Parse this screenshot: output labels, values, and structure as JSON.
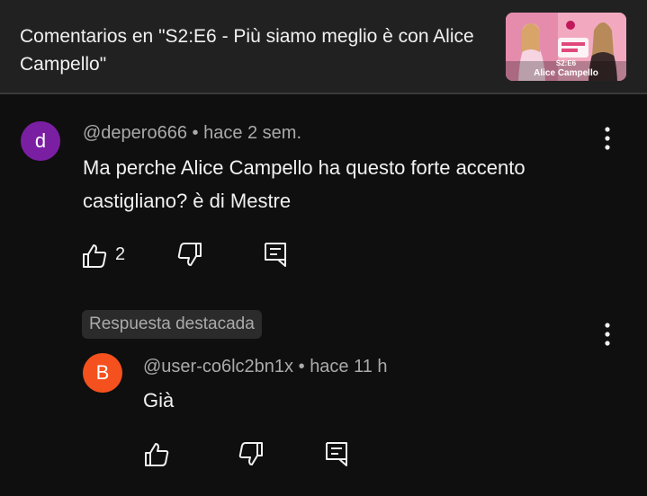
{
  "header": {
    "title": "Comentarios en \"S2:E6 - Più siamo meglio è con Alice Campello\"",
    "thumbnail": {
      "episode": "S2:E6",
      "name": "Alice Campello"
    }
  },
  "comments": [
    {
      "avatar_letter": "d",
      "avatar_color": "#7b1fa2",
      "author": "@depero666",
      "time": "hace 2 sem.",
      "text": "Ma perche Alice Campello ha questo forte accento castigliano? è di Mestre",
      "likes": "2"
    }
  ],
  "reply_section": {
    "badge": "Respuesta destacada"
  },
  "replies": [
    {
      "avatar_letter": "B",
      "avatar_color": "#f4511e",
      "author": "@user-co6lc2bn1x",
      "time": "hace 11 h",
      "text": "Già"
    }
  ],
  "icons": {
    "like": "thumbs-up-icon",
    "dislike": "thumbs-down-icon",
    "reply": "reply-comment-icon",
    "more": "more-vertical-icon"
  },
  "separator": " • "
}
